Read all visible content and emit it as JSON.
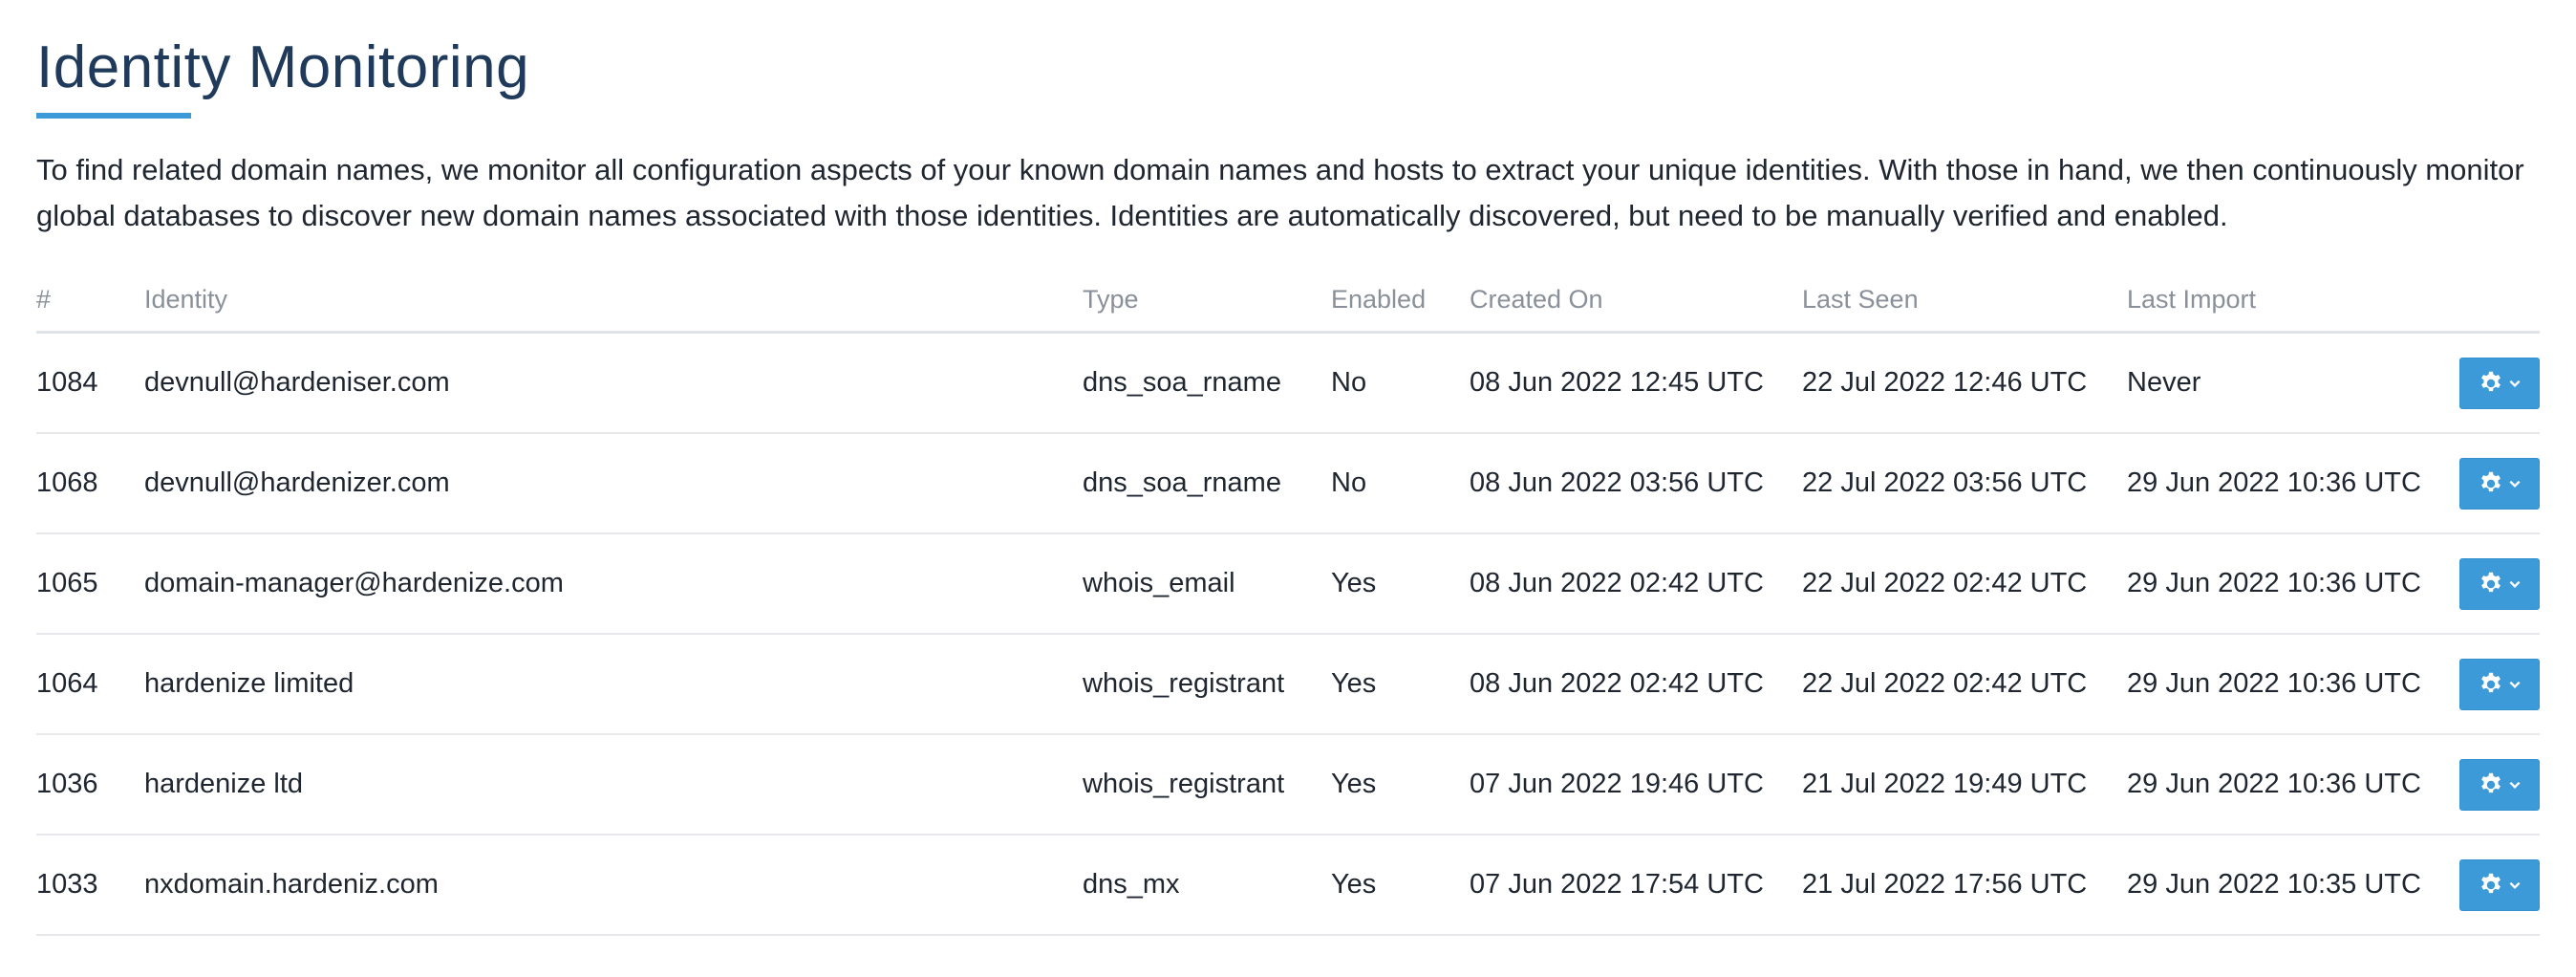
{
  "page": {
    "title": "Identity Monitoring",
    "description": "To find related domain names, we monitor all configuration aspects of your known domain names and hosts to extract your unique identities. With those in hand, we then continuously monitor global databases to discover new domain names associated with those identities. Identities are automatically discovered, but need to be manually verified and enabled."
  },
  "colors": {
    "accent": "#3d9ad8",
    "title": "#1f3a5a",
    "header_text": "#8a9099"
  },
  "table": {
    "headers": {
      "num": "#",
      "identity": "Identity",
      "type": "Type",
      "enabled": "Enabled",
      "created_on": "Created On",
      "last_seen": "Last Seen",
      "last_import": "Last Import"
    },
    "rows": [
      {
        "num": "1084",
        "identity": "devnull@hardeniser.com",
        "type": "dns_soa_rname",
        "enabled": "No",
        "created_on": "08 Jun 2022 12:45 UTC",
        "last_seen": "22 Jul 2022 12:46 UTC",
        "last_import": "Never",
        "action_icon": "gear-icon"
      },
      {
        "num": "1068",
        "identity": "devnull@hardenizer.com",
        "type": "dns_soa_rname",
        "enabled": "No",
        "created_on": "08 Jun 2022 03:56 UTC",
        "last_seen": "22 Jul 2022 03:56 UTC",
        "last_import": "29 Jun 2022 10:36 UTC",
        "action_icon": "gear-icon"
      },
      {
        "num": "1065",
        "identity": "domain-manager@hardenize.com",
        "type": "whois_email",
        "enabled": "Yes",
        "created_on": "08 Jun 2022 02:42 UTC",
        "last_seen": "22 Jul 2022 02:42 UTC",
        "last_import": "29 Jun 2022 10:36 UTC",
        "action_icon": "gear-icon"
      },
      {
        "num": "1064",
        "identity": "hardenize limited",
        "type": "whois_registrant",
        "enabled": "Yes",
        "created_on": "08 Jun 2022 02:42 UTC",
        "last_seen": "22 Jul 2022 02:42 UTC",
        "last_import": "29 Jun 2022 10:36 UTC",
        "action_icon": "gear-icon"
      },
      {
        "num": "1036",
        "identity": "hardenize ltd",
        "type": "whois_registrant",
        "enabled": "Yes",
        "created_on": "07 Jun 2022 19:46 UTC",
        "last_seen": "21 Jul 2022 19:49 UTC",
        "last_import": "29 Jun 2022 10:36 UTC",
        "action_icon": "gear-icon"
      },
      {
        "num": "1033",
        "identity": "nxdomain.hardeniz.com",
        "type": "dns_mx",
        "enabled": "Yes",
        "created_on": "07 Jun 2022 17:54 UTC",
        "last_seen": "21 Jul 2022 17:56 UTC",
        "last_import": "29 Jun 2022 10:35 UTC",
        "action_icon": "gear-icon"
      }
    ]
  }
}
